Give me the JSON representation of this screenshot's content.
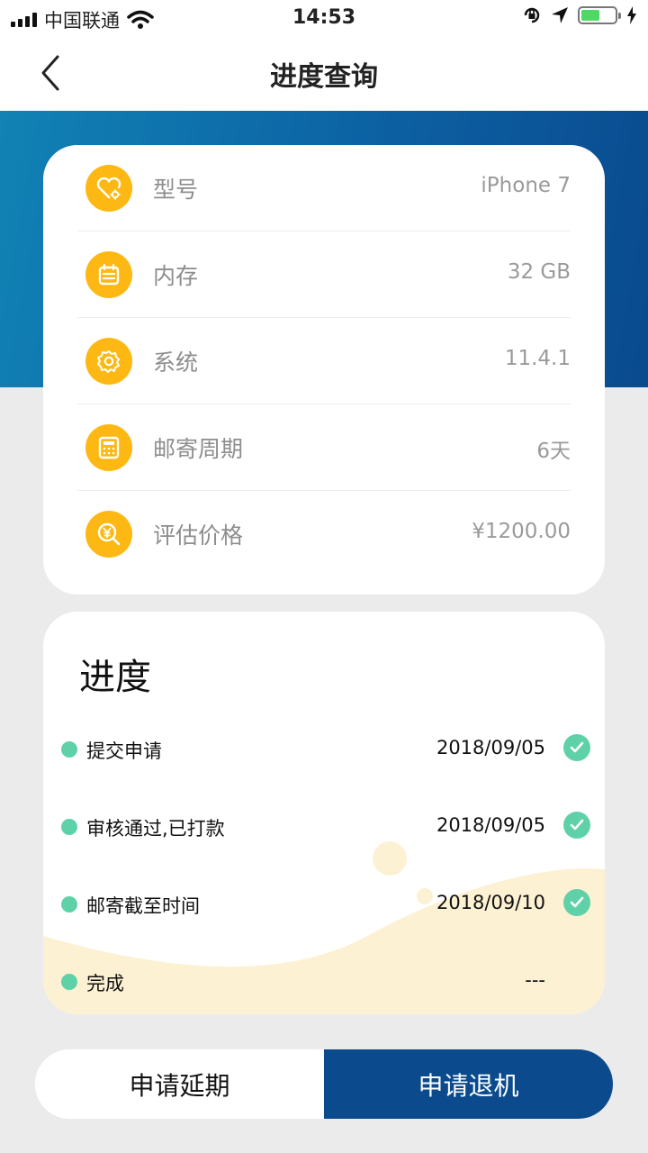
{
  "status_bar": {
    "carrier": "中国联通",
    "time": "14:53",
    "battery_level": 0.55,
    "battery_color": "#4cd964"
  },
  "nav": {
    "title": "进度查询",
    "back_icon": "chevron-left-icon"
  },
  "colors": {
    "banner": "#0c61a3",
    "icon_bg": "#fdb813",
    "step_dot": "#5fd1a8",
    "primary_button": "#0b4a8c"
  },
  "device_info": [
    {
      "icon": "heart-gear-icon",
      "label": "型号",
      "value": "iPhone 7"
    },
    {
      "icon": "calendar-icon",
      "label": "内存",
      "value": "32 GB"
    },
    {
      "icon": "gear-icon",
      "label": "系统",
      "value": "11.4.1"
    },
    {
      "icon": "calculator-icon",
      "label": "邮寄周期",
      "value": "6天"
    },
    {
      "icon": "yen-search-icon",
      "label": "评估价格",
      "value": "¥1200.00"
    }
  ],
  "progress": {
    "heading": "进度",
    "steps": [
      {
        "name": "提交申请",
        "date": "2018/09/05",
        "done": true
      },
      {
        "name": "审核通过,已打款",
        "date": "2018/09/05",
        "done": true
      },
      {
        "name": "邮寄截至时间",
        "date": "2018/09/10",
        "done": true
      },
      {
        "name": "完成",
        "date": "---",
        "done": false
      }
    ]
  },
  "actions": {
    "extend_label": "申请延期",
    "return_label": "申请退机"
  }
}
